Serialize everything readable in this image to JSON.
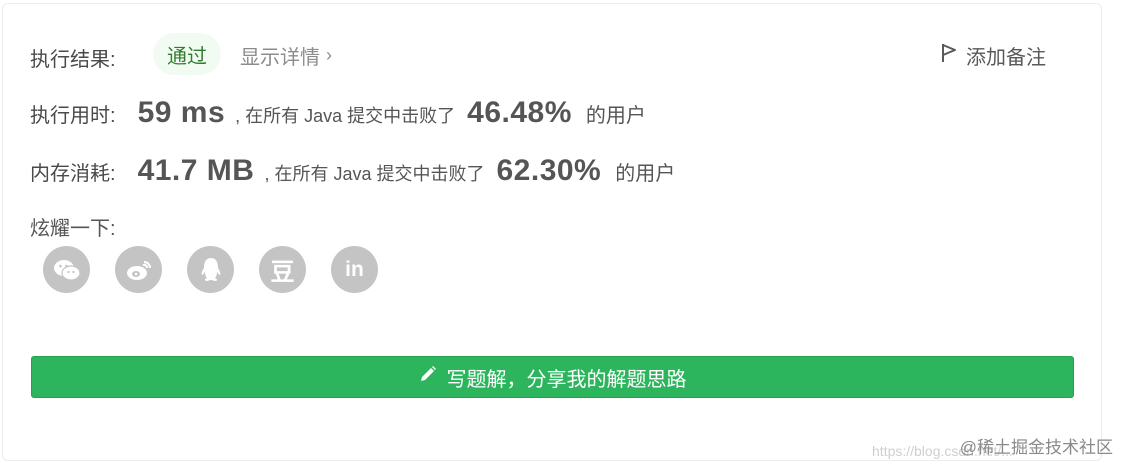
{
  "result": {
    "label": "执行结果:",
    "status": "通过",
    "detail_link": "显示详情",
    "add_note": "添加备注"
  },
  "runtime": {
    "label": "执行用时:",
    "value": "59 ms",
    "text_before": ", 在所有 Java 提交中击败了",
    "percent": "46.48%",
    "text_after": "的用户"
  },
  "memory": {
    "label": "内存消耗:",
    "value": "41.7 MB",
    "text_before": ", 在所有 Java 提交中击败了",
    "percent": "62.30%",
    "text_after": "的用户"
  },
  "share": {
    "label": "炫耀一下:",
    "icons": [
      "wechat-icon",
      "weibo-icon",
      "qq-icon",
      "douban-icon",
      "linkedin-icon"
    ],
    "douban_glyph": "豆",
    "linkedin_glyph": "in"
  },
  "write_button": {
    "label": "写题解，分享我的解题思路"
  },
  "watermark": {
    "text": "@稀土掘金技术社区",
    "faint_text": "https://blog.csdn.net/..."
  },
  "colors": {
    "accent": "#2db55d",
    "icon_gray": "#c4c4c4",
    "badge_bg": "#f2fbf2"
  }
}
